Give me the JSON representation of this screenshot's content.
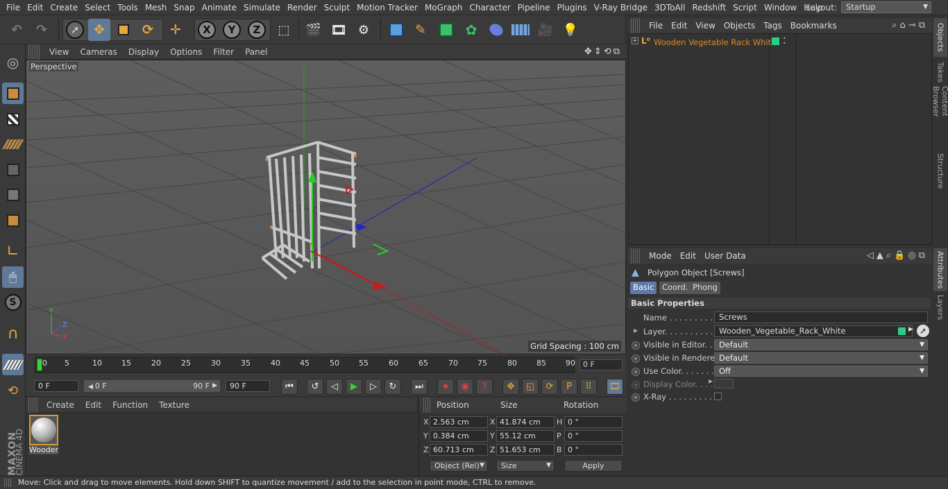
{
  "menubar": {
    "items": [
      "File",
      "Edit",
      "Create",
      "Select",
      "Tools",
      "Mesh",
      "Snap",
      "Animate",
      "Simulate",
      "Render",
      "Sculpt",
      "Motion Tracker",
      "MoGraph",
      "Character",
      "Pipeline",
      "Plugins",
      "V-Ray Bridge",
      "3DToAll",
      "Redshift",
      "Script",
      "Window",
      "Help"
    ],
    "layout_label": "Layout:",
    "layout_value": "Startup"
  },
  "toolbar": {
    "axis_x": "X",
    "axis_y": "Y",
    "axis_z": "Z"
  },
  "viewport": {
    "menu": [
      "View",
      "Cameras",
      "Display",
      "Options",
      "Filter",
      "Panel"
    ],
    "label": "Perspective",
    "grid_spacing": "Grid Spacing : 100 cm"
  },
  "timeline": {
    "ticks": [
      "0",
      "5",
      "10",
      "15",
      "20",
      "25",
      "30",
      "35",
      "40",
      "45",
      "50",
      "55",
      "60",
      "65",
      "70",
      "75",
      "80",
      "85",
      "90"
    ],
    "current_frame": "0 F",
    "start": "0 F",
    "range_start": "0 F",
    "range_end": "90 F",
    "end": "90 F"
  },
  "materials": {
    "menu": [
      "Create",
      "Edit",
      "Function",
      "Texture"
    ],
    "items": [
      {
        "name": "Wooden"
      }
    ]
  },
  "coords": {
    "headers": {
      "position": "Position",
      "size": "Size",
      "rotation": "Rotation"
    },
    "rows": [
      {
        "axis": "X",
        "position": "2.563 cm",
        "size": "41.874 cm",
        "rotation": "0 °"
      },
      {
        "axis": "Y",
        "position": "0.384 cm",
        "size": "55.12 cm",
        "rotation": "0 °"
      },
      {
        "axis": "Z",
        "position": "60.713 cm",
        "size": "51.653 cm",
        "rotation": "0 °"
      }
    ],
    "mode": "Object (Rel)",
    "size_mode": "Size",
    "apply": "Apply"
  },
  "object_manager": {
    "menu": [
      "File",
      "Edit",
      "View",
      "Objects",
      "Tags",
      "Bookmarks"
    ],
    "object_name": "Wooden Vegetable Rack White"
  },
  "right_tabs": [
    "Objects",
    "Takes",
    "Content Browser",
    "Structure",
    "Attributes",
    "Layers"
  ],
  "attributes": {
    "menu": [
      "Mode",
      "Edit",
      "User Data"
    ],
    "object_title": "Polygon Object [Screws]",
    "tabs": [
      "Basic",
      "Coord.",
      "Phong"
    ],
    "section": "Basic Properties",
    "props": [
      {
        "label": "Name . . . . . . . . . . . .",
        "value": "Screws"
      },
      {
        "label": "Layer. . . . . . . . . . . .",
        "value": "Wooden_Vegetable_Rack_White"
      },
      {
        "label": "Visible in Editor. . .",
        "value": "Default"
      },
      {
        "label": "Visible in Renderer",
        "value": "Default"
      },
      {
        "label": "Use Color. . . . . . . .",
        "value": "Off"
      },
      {
        "label": "Display Color. . . .",
        "value": ""
      },
      {
        "label": "X-Ray . . . . . . . . . . .",
        "value": ""
      }
    ]
  },
  "status": "Move: Click and drag to move elements. Hold down SHIFT to quantize movement / add to the selection in point mode, CTRL to remove.",
  "brand": {
    "line1": "MAXON",
    "line2": "CINEMA 4D"
  },
  "colors": {
    "accent": "#5b7aa8",
    "object_orange": "#d88b25",
    "layer_green": "#2ecc8a"
  }
}
